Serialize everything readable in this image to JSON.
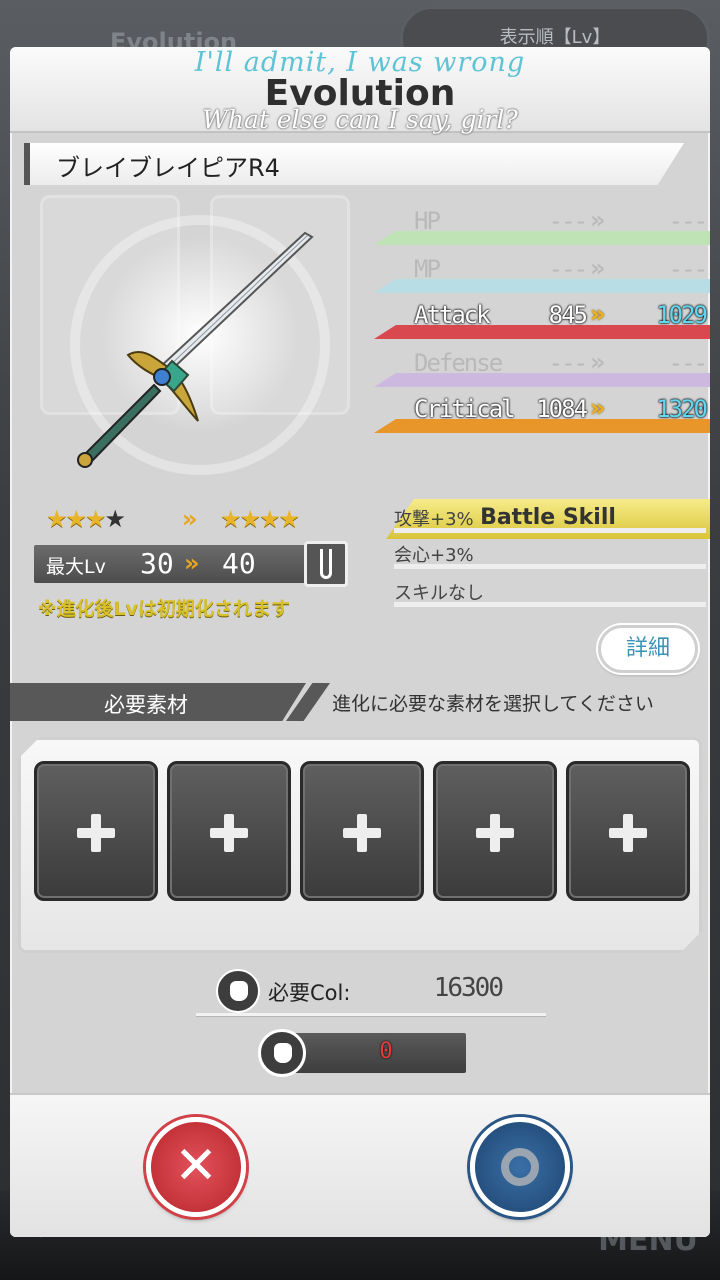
{
  "background": {
    "screen_title": "Evolution",
    "sort_button": "表示順【Lv】",
    "menu_label": "MENU"
  },
  "dialog": {
    "caption_top": "I'll admit, I was wrong",
    "title": "Evolution",
    "caption_bottom": "What else can I say, girl?"
  },
  "item": {
    "name": "ブレイブレイピアR4"
  },
  "rarity": {
    "before_filled": "★★★",
    "before_empty": "★",
    "arrow": "»",
    "after": "★★★★"
  },
  "level": {
    "label": "最大Lv",
    "from": "30",
    "arrow": "»",
    "to": "40",
    "notice": "※進化後Lvは初期化されます"
  },
  "stats": [
    {
      "name": "HP",
      "from": "---",
      "arrow": "»",
      "to": "---",
      "active": false,
      "color": "#bfe3b4"
    },
    {
      "name": "MP",
      "from": "---",
      "arrow": "»",
      "to": "---",
      "active": false,
      "color": "#b9dde4"
    },
    {
      "name": "Attack",
      "from": "845",
      "arrow": "»",
      "to": "1029",
      "active": true,
      "color": "#d9474f"
    },
    {
      "name": "Defense",
      "from": "---",
      "arrow": "»",
      "to": "---",
      "active": false,
      "color": "#cdb8e0"
    },
    {
      "name": "Critical",
      "from": "1084",
      "arrow": "»",
      "to": "1320",
      "active": true,
      "color": "#e8952a"
    }
  ],
  "battle_skill": {
    "header": "Battle Skill",
    "lines": [
      "攻撃+3%",
      "会心+3%",
      "スキルなし"
    ]
  },
  "detail_button": "詳細",
  "materials": {
    "label": "必要素材",
    "hint": "進化に必要な素材を選択してください",
    "slots": 5
  },
  "cost": {
    "label": "必要Col:",
    "value": "16300",
    "owned": "0"
  },
  "colors": {
    "accent_yellow": "#e8c93a",
    "cancel_red": "#c8323a",
    "ok_blue": "#2b5787"
  }
}
